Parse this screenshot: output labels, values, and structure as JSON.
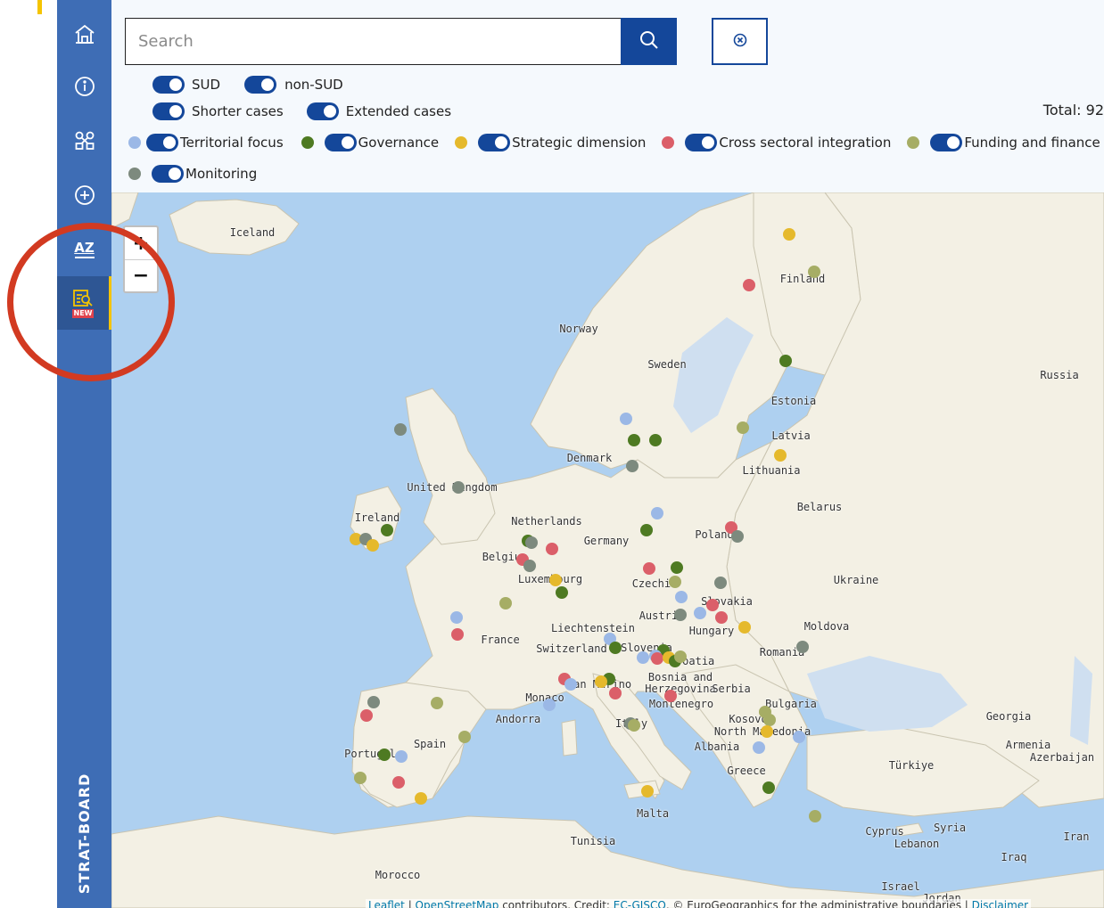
{
  "sidebar": {
    "items": [
      {
        "icon": "home-icon"
      },
      {
        "icon": "info-icon"
      },
      {
        "icon": "network-icon"
      },
      {
        "icon": "add-icon"
      },
      {
        "label": "AZ"
      },
      {
        "icon": "search-doc-icon",
        "badge": "NEW"
      }
    ],
    "brand": "STRAT-BOARD"
  },
  "search": {
    "placeholder": "Search"
  },
  "filters": {
    "sud": "SUD",
    "non_sud": "non-SUD",
    "shorter": "Shorter cases",
    "extended": "Extended cases",
    "categories": [
      {
        "label": "Territorial focus",
        "color": "#9bb8e6"
      },
      {
        "label": "Governance",
        "color": "#4e7a22"
      },
      {
        "label": "Strategic dimension",
        "color": "#e5b92c"
      },
      {
        "label": "Cross sectoral integration",
        "color": "#db5f69"
      },
      {
        "label": "Funding and finance",
        "color": "#a6ad65"
      },
      {
        "label": "Monitoring",
        "color": "#7d8a7e"
      }
    ]
  },
  "total": "Total: 92",
  "map": {
    "labels": {
      "iceland": "Iceland",
      "finland": "Finland",
      "norway": "Norway",
      "sweden": "Sweden",
      "russia": "Russia",
      "estonia": "Estonia",
      "latvia": "Latvia",
      "lithuania": "Lithuania",
      "denmark": "Denmark",
      "uk": "United Kingdom",
      "belarus": "Belarus",
      "ireland": "Ireland",
      "netherlands": "Netherlands",
      "germany": "Germany",
      "poland": "Poland",
      "belgium": "Belgium",
      "luxembourg": "Luxembourg",
      "czechia": "Czechia",
      "ukraine": "Ukraine",
      "slovakia": "Slovakia",
      "austria": "Austria",
      "liechtenstein": "Liechtenstein",
      "moldova": "Moldova",
      "france": "France",
      "hungary": "Hungary",
      "switzerland": "Switzerland",
      "slovenia": "Slovenia",
      "croatia": "Croatia",
      "romania": "Romania",
      "bosnia": "Bosnia and\nHerzegovina",
      "serbia": "Serbia",
      "san_marino": "San Marino",
      "monaco": "Monaco",
      "montenegro": "Montenegro",
      "bulgaria": "Bulgaria",
      "andorra": "Andorra",
      "kosovo": "Kosovo",
      "italy": "Italy",
      "georgia": "Georgia",
      "north_macedonia": "North Macedonia",
      "spain": "Spain",
      "albania": "Albania",
      "armenia": "Armenia",
      "azerbaijan": "Azerbaijan",
      "portugal": "Portugal",
      "greece": "Greece",
      "turkiye": "Türkiye",
      "malta": "Malta",
      "cyprus": "Cyprus",
      "syria": "Syria",
      "lebanon": "Lebanon",
      "tunisia": "Tunisia",
      "iran": "Iran",
      "iraq": "Iraq",
      "morocco": "Morocco",
      "israel": "Israel",
      "jordan": "Jordan"
    },
    "zoom_in": "+",
    "zoom_out": "−",
    "attribution_leaflet": "Leaflet",
    "attribution_osm": "OpenStreetMap",
    "attribution_mid": " contributors, Credit: ",
    "attribution_ec": "EC-GISCO",
    "attribution_tail": ", © EuroGeographics for the administrative boundaries | ",
    "attribution_disclaimer": "Disclaimer"
  }
}
